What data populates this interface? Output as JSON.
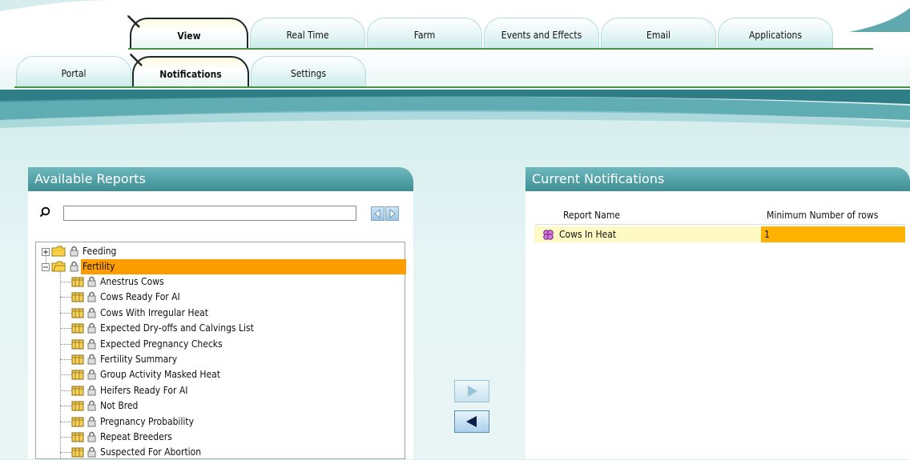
{
  "tabs_top": [
    {
      "label": "View",
      "active": true
    },
    {
      "label": "Real Time",
      "active": false
    },
    {
      "label": "Farm",
      "active": false
    },
    {
      "label": "Events and Effects",
      "active": false
    },
    {
      "label": "Email",
      "active": false
    },
    {
      "label": "Applications",
      "active": false
    }
  ],
  "tabs_sub": [
    {
      "label": "Portal",
      "active": false
    },
    {
      "label": "Notifications",
      "active": true
    },
    {
      "label": "Settings",
      "active": false
    }
  ],
  "available_reports": {
    "title": "Available Reports",
    "search": {
      "value": "",
      "placeholder": ""
    },
    "tree": [
      {
        "label": "Feeding",
        "type": "folder",
        "expanded": false,
        "selected": false
      },
      {
        "label": "Fertility",
        "type": "folder",
        "expanded": true,
        "selected": true
      },
      {
        "label": "Anestrus Cows",
        "type": "report"
      },
      {
        "label": "Cows Ready For AI",
        "type": "report"
      },
      {
        "label": "Cows With Irregular Heat",
        "type": "report"
      },
      {
        "label": "Expected Dry-offs and Calvings List",
        "type": "report"
      },
      {
        "label": "Expected Pregnancy Checks",
        "type": "report"
      },
      {
        "label": "Fertility Summary",
        "type": "report"
      },
      {
        "label": "Group Activity Masked Heat",
        "type": "report"
      },
      {
        "label": "Heifers Ready For AI",
        "type": "report"
      },
      {
        "label": "Not Bred",
        "type": "report"
      },
      {
        "label": "Pregnancy Probability",
        "type": "report"
      },
      {
        "label": "Repeat Breeders",
        "type": "report"
      },
      {
        "label": "Suspected For Abortion",
        "type": "report"
      }
    ]
  },
  "current_notifications": {
    "title": "Current Notifications",
    "columns": [
      "Report Name",
      "Minimum Number of rows"
    ],
    "rows": [
      {
        "report_name": "Cows In Heat",
        "min_rows": "1"
      }
    ]
  },
  "colors": {
    "selection": "#ff9d00",
    "row_highlight": "#fff9c4",
    "panel_header": "#4f9ea3",
    "divider_green": "#4c8f45"
  },
  "icons": {
    "search": "magnifier-icon",
    "folder": "folder-icon",
    "lock": "lock-icon",
    "report": "report-icon",
    "notification": "cows-icon",
    "add": "arrow-right-icon",
    "remove": "arrow-left-icon"
  }
}
